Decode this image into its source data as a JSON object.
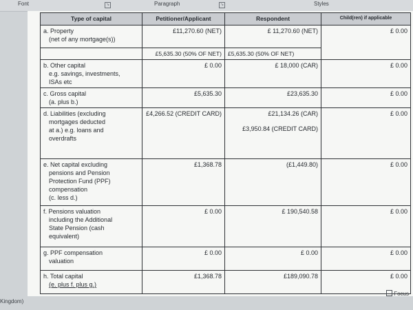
{
  "ribbon": {
    "font_group": "Font",
    "paragraph_group": "Paragraph",
    "styles_group": "Styles"
  },
  "table": {
    "headers": {
      "type": "Type of capital",
      "petitioner": "Petitioner/Applicant",
      "respondent": "Respondent",
      "child": "Child(ren) if applicable"
    },
    "rows": [
      {
        "label_lines": [
          "a. Property",
          "(net of any mortgage(s))"
        ],
        "petitioner": "£11,270.60 (NET)",
        "respondent": "£ 11,270.60 (NET)",
        "child": "£ 0.00",
        "petitioner_split": "£5,635.30 (50% OF NET)",
        "respondent_split": "£5,635.30 (50% OF NET)"
      },
      {
        "label_lines": [
          "b. Other capital",
          "e.g. savings, investments,",
          "ISAs etc"
        ],
        "petitioner": "£ 0.00",
        "respondent": "£ 18,000 (CAR)",
        "child": "£ 0.00"
      },
      {
        "label_lines": [
          "c. Gross capital",
          "(a. plus b.)"
        ],
        "petitioner": "£5,635.30",
        "respondent": "£23,635.30",
        "child": "£  0.00"
      },
      {
        "label_lines": [
          "d. Liabilities (excluding",
          "mortgages deducted",
          "at a.) e.g. loans and",
          "overdrafts"
        ],
        "petitioner": "£4,266.52 (CREDIT CARD)",
        "respondent": "£21,134.26 (CAR)",
        "respondent_extra": "£3,950.84 (CREDIT CARD)",
        "child": "£ 0.00"
      },
      {
        "label_lines": [
          "e. Net capital excluding",
          "pensions and Pension",
          "Protection Fund (PPF)",
          "compensation",
          "(c. less d.)"
        ],
        "petitioner": "£1,368.78",
        "respondent": "(£1,449.80)",
        "child": "£  0.00"
      },
      {
        "label_lines": [
          "f. Pensions valuation",
          "including the Additional",
          "State Pension (cash",
          "equivalent)"
        ],
        "petitioner": "£ 0.00",
        "respondent": "£ 190,540.58",
        "child": "£ 0.00"
      },
      {
        "label_lines": [
          "g. PPF compensation",
          "valuation"
        ],
        "petitioner": "£ 0.00",
        "respondent": "£ 0.00",
        "child": "£ 0.00"
      },
      {
        "label_lines": [
          "h. Total capital",
          "(e. plus f. plus g.)"
        ],
        "petitioner": "£1,368.78",
        "respondent": "£189,090.78",
        "child": "£  0.00"
      }
    ]
  },
  "status_bar": {
    "language": "Kingdom)",
    "focus_label": "Focus"
  }
}
